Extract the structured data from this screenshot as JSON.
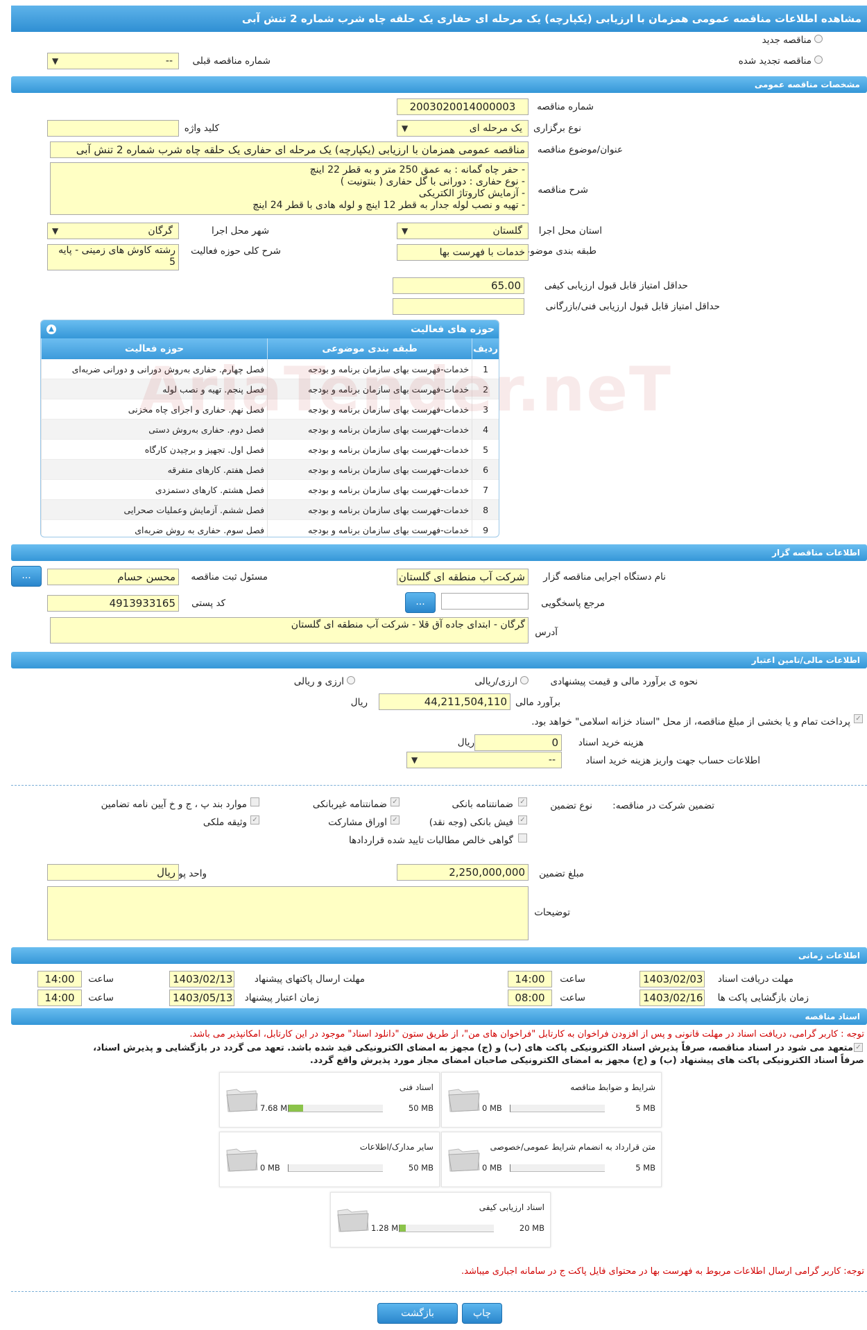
{
  "title": "مشاهده اطلاعات مناقصه عمومی همزمان با ارزیابی (یکپارچه) یک مرحله ای حفاری یک حلقه چاه شرب شماره 2 تنش آبی",
  "tender_type": {
    "new_label": "مناقصه جدید",
    "renewed_label": "مناقصه تجدید شده",
    "prev_number_label": "شماره مناقصه قبلی",
    "prev_number_value": "--"
  },
  "general": {
    "section_title": "مشخصات مناقصه عمومی",
    "number_label": "شماره مناقصه",
    "number_value": "2003020014000003",
    "holding_type_label": "نوع برگزاری",
    "holding_type_value": "یک مرحله ای",
    "keyword_label": "کلید واژه",
    "keyword_value": "",
    "subject_label": "عنوان/موضوع مناقصه",
    "subject_value": "مناقصه عمومی همزمان با ارزیابی (یکپارچه) یک مرحله ای حفاری یک حلقه چاه شرب شماره 2 تنش آبی",
    "description_label": "شرح مناقصه",
    "description_lines": [
      "-      حفر چاه گمانه : به عمق 250 متر و به قطر 22 اینچ",
      "-      نوع حفاری : دورانی با گل حفاری ( بنتونیت )",
      "-      آزمایش کاروتاژ الکتریکی",
      "-      تهیه و نصب لوله جدار به قطر 12 اینچ و لوله هادی با قطر 24 اینچ"
    ],
    "province_label": "استان محل اجرا",
    "province_value": "گلستان",
    "city_label": "شهر محل اجرا",
    "city_value": "گرگان",
    "category_label": "طبقه بندی موضوعی",
    "category_value": "خدمات با فهرست بها",
    "activity_desc_label": "شرح کلی حوزه فعالیت",
    "activity_desc_value": "رشته کاوش های زمینی - پایه 5",
    "min_quality_label": "حداقل امتیاز قابل قبول ارزیابی کیفی",
    "min_quality_value": "65.00",
    "min_tech_label": "حداقل امتیاز قابل قبول ارزیابی فنی/بازرگانی",
    "min_tech_value": ""
  },
  "activities": {
    "title": "حوزه های فعالیت",
    "columns": [
      "ردیف",
      "طبقه بندی موضوعی",
      "حوزه فعالیت"
    ],
    "rows": [
      {
        "n": "1",
        "cat": "خدمات-فهرست بهای سازمان برنامه و بودجه",
        "act": "فصل چهارم. حفاری به‌روش دورانی و دورانی ضربه‌ای"
      },
      {
        "n": "2",
        "cat": "خدمات-فهرست بهای سازمان برنامه و بودجه",
        "act": "فصل پنجم. تهیه و نصب لوله"
      },
      {
        "n": "3",
        "cat": "خدمات-فهرست بهای سازمان برنامه و بودجه",
        "act": "فصل نهم. حفاری و اجرای چاه مخزنی"
      },
      {
        "n": "4",
        "cat": "خدمات-فهرست بهای سازمان برنامه و بودجه",
        "act": "فصل دوم. حفاری به‌روش دستی"
      },
      {
        "n": "5",
        "cat": "خدمات-فهرست بهای سازمان برنامه و بودجه",
        "act": "فصل اول. تجهیز و برچیدن کارگاه"
      },
      {
        "n": "6",
        "cat": "خدمات-فهرست بهای سازمان برنامه و بودجه",
        "act": "فصل هفتم. کارهای متفرقه"
      },
      {
        "n": "7",
        "cat": "خدمات-فهرست بهای سازمان برنامه و بودجه",
        "act": "فصل هشتم. کارهای دستمزدی"
      },
      {
        "n": "8",
        "cat": "خدمات-فهرست بهای سازمان برنامه و بودجه",
        "act": "فصل ششم. آزمایش وعملیات صحرایی"
      },
      {
        "n": "9",
        "cat": "خدمات-فهرست بهای سازمان برنامه و بودجه",
        "act": "فصل سوم. حفاری به روش ضربه‌ای"
      }
    ]
  },
  "organizer": {
    "section_title": "اطلاعات مناقصه گزار",
    "org_name_label": "نام دستگاه اجرایی مناقصه گزار",
    "org_name_value": "شرکت آب منطقه ای گلستان",
    "registrar_label": "مسئول ثبت مناقصه",
    "registrar_value": "محسن حسام",
    "reference_label": "مرجع پاسخگویی",
    "reference_value": "",
    "postal_label": "کد پستی",
    "postal_value": "4913933165",
    "address_label": "آدرس",
    "address_value": "گرگان - ابتدای جاده آق قلا - شرکت آب منطقه ای گلستان",
    "dots": "..."
  },
  "financial": {
    "section_title": "اطلاعات مالی/تامین اعتبار",
    "estimate_method_label": "نحوه ی برآورد مالی و قیمت پیشنهادی",
    "opt_currency_rial": "ارزی/ریالی",
    "opt_currency_and_rial": "ارزی و ریالی",
    "estimate_label": "برآورد مالی",
    "estimate_value": "44,211,504,110",
    "rial": "ریال",
    "treasury_note": "پرداخت تمام و یا بخشی از مبلغ مناقصه، از محل \"اسناد خزانه اسلامی\" خواهد بود.",
    "doc_cost_label": "هزینه خرید اسناد",
    "doc_cost_value": "0",
    "account_label": "اطلاعات حساب جهت واریز هزینه خرید اسناد",
    "account_value": "--"
  },
  "guarantee": {
    "participation_label": "تضمین شرکت در مناقصه:",
    "type_label": "نوع تضمین",
    "options": [
      {
        "label": "ضمانتنامه بانکی"
      },
      {
        "label": "ضمانتنامه غیربانکی"
      },
      {
        "label": "موارد بند پ ، ج و خ آیین نامه تضامین"
      },
      {
        "label": "فیش بانکی (وجه نقد)"
      },
      {
        "label": "اوراق مشارکت"
      },
      {
        "label": "وثیقه ملکی"
      },
      {
        "label": "گواهی خالص مطالبات تایید شده قراردادها"
      }
    ],
    "amount_label": "مبلغ تضمین",
    "amount_value": "2,250,000,000",
    "currency_label": "واحد پول",
    "currency_value": "ریال",
    "notes_label": "توضیحات",
    "notes_value": ""
  },
  "timing": {
    "section_title": "اطلاعات زمانی",
    "doc_receive_label": "مهلت دریافت اسناد",
    "doc_receive_date": "1403/02/03",
    "doc_receive_time": "14:00",
    "send_deadline_label": "مهلت ارسال پاکتهای پیشنهاد",
    "send_deadline_date": "1403/02/13",
    "send_deadline_time": "14:00",
    "open_label": "زمان بازگشایی پاکت ها",
    "open_date": "1403/02/16",
    "open_time": "08:00",
    "validity_label": "زمان اعتبار پیشنهاد",
    "validity_date": "1403/05/13",
    "validity_time": "14:00",
    "hour_label": "ساعت"
  },
  "documents": {
    "section_title": "اسناد مناقصه",
    "note1": "توجه : کاربر گرامی، دریافت اسناد در مهلت قانونی و پس از افزودن فراخوان به کارتابل \"فراخوان های من\"، از طریق ستون \"دانلود اسناد\" موجود در این کارتابل، امکانپذیر می باشد.",
    "commit_line1": "متعهد می شود در اسناد مناقصه، صرفاً پذیرش اسناد الکترونیکی پاکت های (ب) و (ج) مجهز به امضای الکترونیکی قید شده باشد. تعهد می گردد در بازگشایی و پذیرش اسناد،",
    "commit_line2": "صرفاً اسناد الکترونیکی پاکت های پیشنهاد (ب) و (ج) مجهز به امضای الکترونیکی صاحبان امضای مجاز مورد پذیرش واقع گردد.",
    "files": [
      {
        "name": "شرایط و ضوابط مناقصه",
        "used": "0 MB",
        "max": "5 MB",
        "fill": 0
      },
      {
        "name": "اسناد فنی",
        "used": "7.68 MB",
        "max": "50 MB",
        "fill": 0.154
      },
      {
        "name": "متن قرارداد به انضمام شرایط عمومی/خصوصی",
        "used": "0 MB",
        "max": "5 MB",
        "fill": 0
      },
      {
        "name": "سایر مدارک/اطلاعات",
        "used": "0 MB",
        "max": "50 MB",
        "fill": 0
      },
      {
        "name": "اسناد ارزیابی کیفی",
        "used": "1.28 MB",
        "max": "20 MB",
        "fill": 0.064
      }
    ],
    "note2": "توجه: کاربر گرامی ارسال اطلاعات مربوط به فهرست بها در محتوای فایل پاکت ج در سامانه اجباری میباشد."
  },
  "buttons": {
    "print": "چاپ",
    "back": "بازگشت"
  },
  "watermark": "AriaTender.neT"
}
